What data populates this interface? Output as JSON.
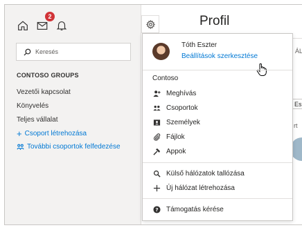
{
  "sidebar": {
    "notification_count": "2",
    "search_placeholder": "Keresés",
    "heading": "CONTOSO GROUPS",
    "items": [
      {
        "label": "Vezetői kapcsolat"
      },
      {
        "label": "Könyvelés"
      },
      {
        "label": "Teljes vállalat"
      }
    ],
    "create_group": "Csoport létrehozása",
    "discover_groups": "További csoportok felfedezése"
  },
  "main": {
    "title": "Profil",
    "peek_texts": [
      "ÁL",
      "Es",
      "rt"
    ]
  },
  "menu": {
    "user_name": "Tóth Eszter",
    "edit_settings": "Beállítások szerkesztése",
    "network_heading": "Contoso",
    "network_items": [
      {
        "label": "Meghívás",
        "icon": "invite-icon"
      },
      {
        "label": "Csoportok",
        "icon": "groups-icon"
      },
      {
        "label": "Személyek",
        "icon": "people-icon"
      },
      {
        "label": "Fájlok",
        "icon": "files-icon"
      },
      {
        "label": "Appok",
        "icon": "apps-icon"
      }
    ],
    "browse_networks": "Külső hálózatok tallózása",
    "new_network": "Új hálózat létrehozása",
    "support": "Támogatás kérése"
  },
  "colors": {
    "accent": "#0078d4",
    "badge": "#d13438",
    "sidebar_bg": "#f3f2f1"
  }
}
